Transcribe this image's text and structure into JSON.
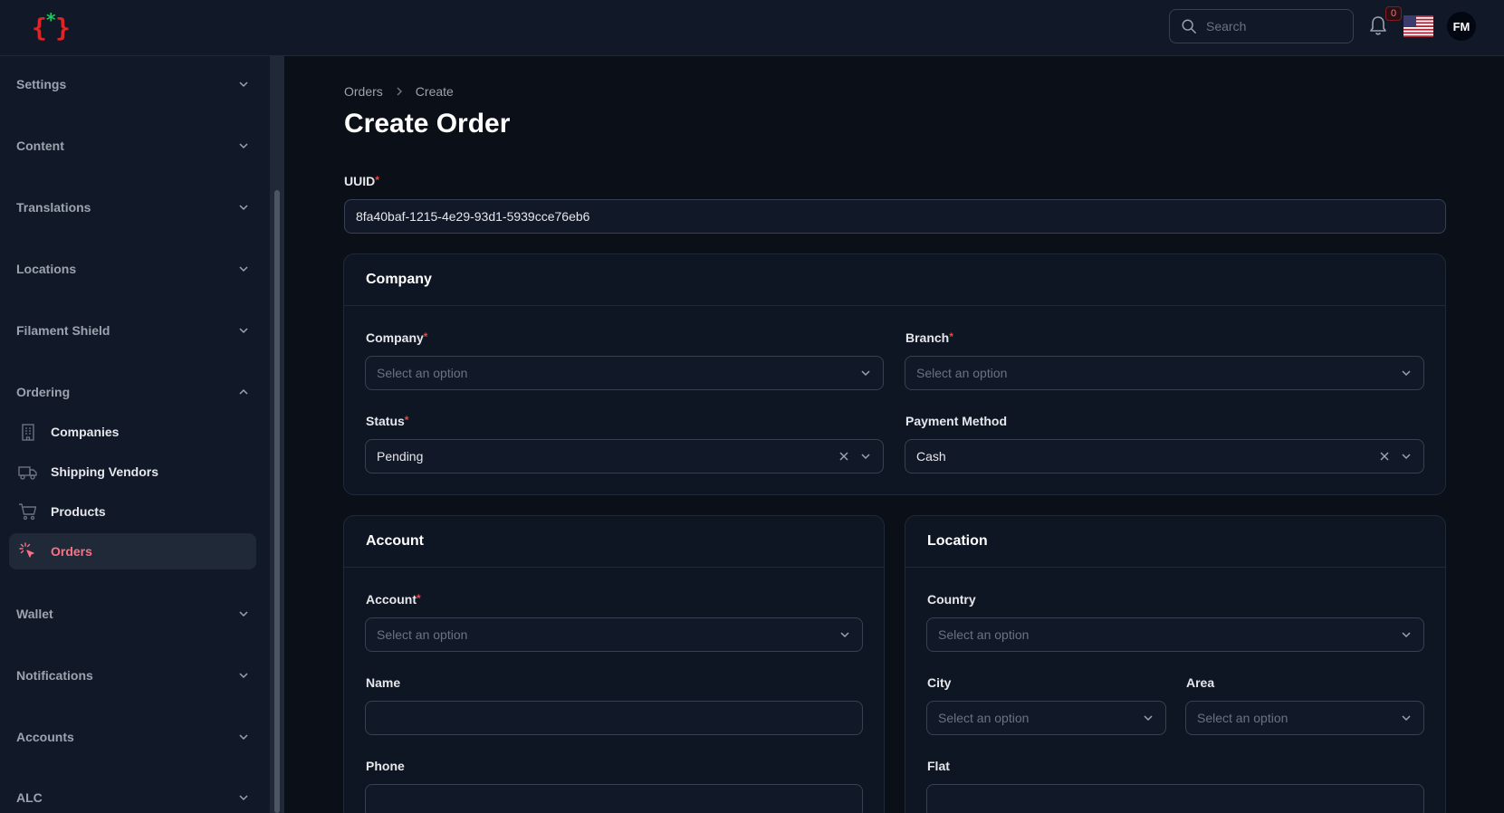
{
  "topbar": {
    "search_placeholder": "Search",
    "notifications_count": "0",
    "avatar_initials": "FM"
  },
  "sidebar": {
    "groups": {
      "settings": "Settings",
      "content": "Content",
      "translations": "Translations",
      "locations": "Locations",
      "filament_shield": "Filament Shield",
      "ordering": "Ordering",
      "wallet": "Wallet",
      "notifications": "Notifications",
      "accounts": "Accounts",
      "alc": "ALC"
    },
    "ordering_items": {
      "companies": "Companies",
      "shipping_vendors": "Shipping Vendors",
      "products": "Products",
      "orders": "Orders"
    },
    "active_item": "Orders"
  },
  "breadcrumb": {
    "parent": "Orders",
    "current": "Create"
  },
  "page_title": "Create Order",
  "form": {
    "uuid_label": "UUID",
    "uuid_value": "8fa40baf-1215-4e29-93d1-5939cce76eb6",
    "required_mark": "*",
    "company_section": {
      "heading": "Company",
      "company_label": "Company",
      "company_placeholder": "Select an option",
      "branch_label": "Branch",
      "branch_placeholder": "Select an option",
      "status_label": "Status",
      "status_value": "Pending",
      "payment_label": "Payment Method",
      "payment_value": "Cash"
    },
    "account_section": {
      "heading": "Account",
      "account_label": "Account",
      "account_placeholder": "Select an option",
      "name_label": "Name",
      "name_value": "",
      "phone_label": "Phone",
      "phone_value": ""
    },
    "location_section": {
      "heading": "Location",
      "country_label": "Country",
      "country_placeholder": "Select an option",
      "city_label": "City",
      "city_placeholder": "Select an option",
      "area_label": "Area",
      "area_placeholder": "Select an option",
      "flat_label": "Flat",
      "flat_value": ""
    }
  },
  "colors": {
    "background": "#0a0f18",
    "sidebar": "#111827",
    "accent": "#fb7185",
    "required": "#ef4444"
  }
}
